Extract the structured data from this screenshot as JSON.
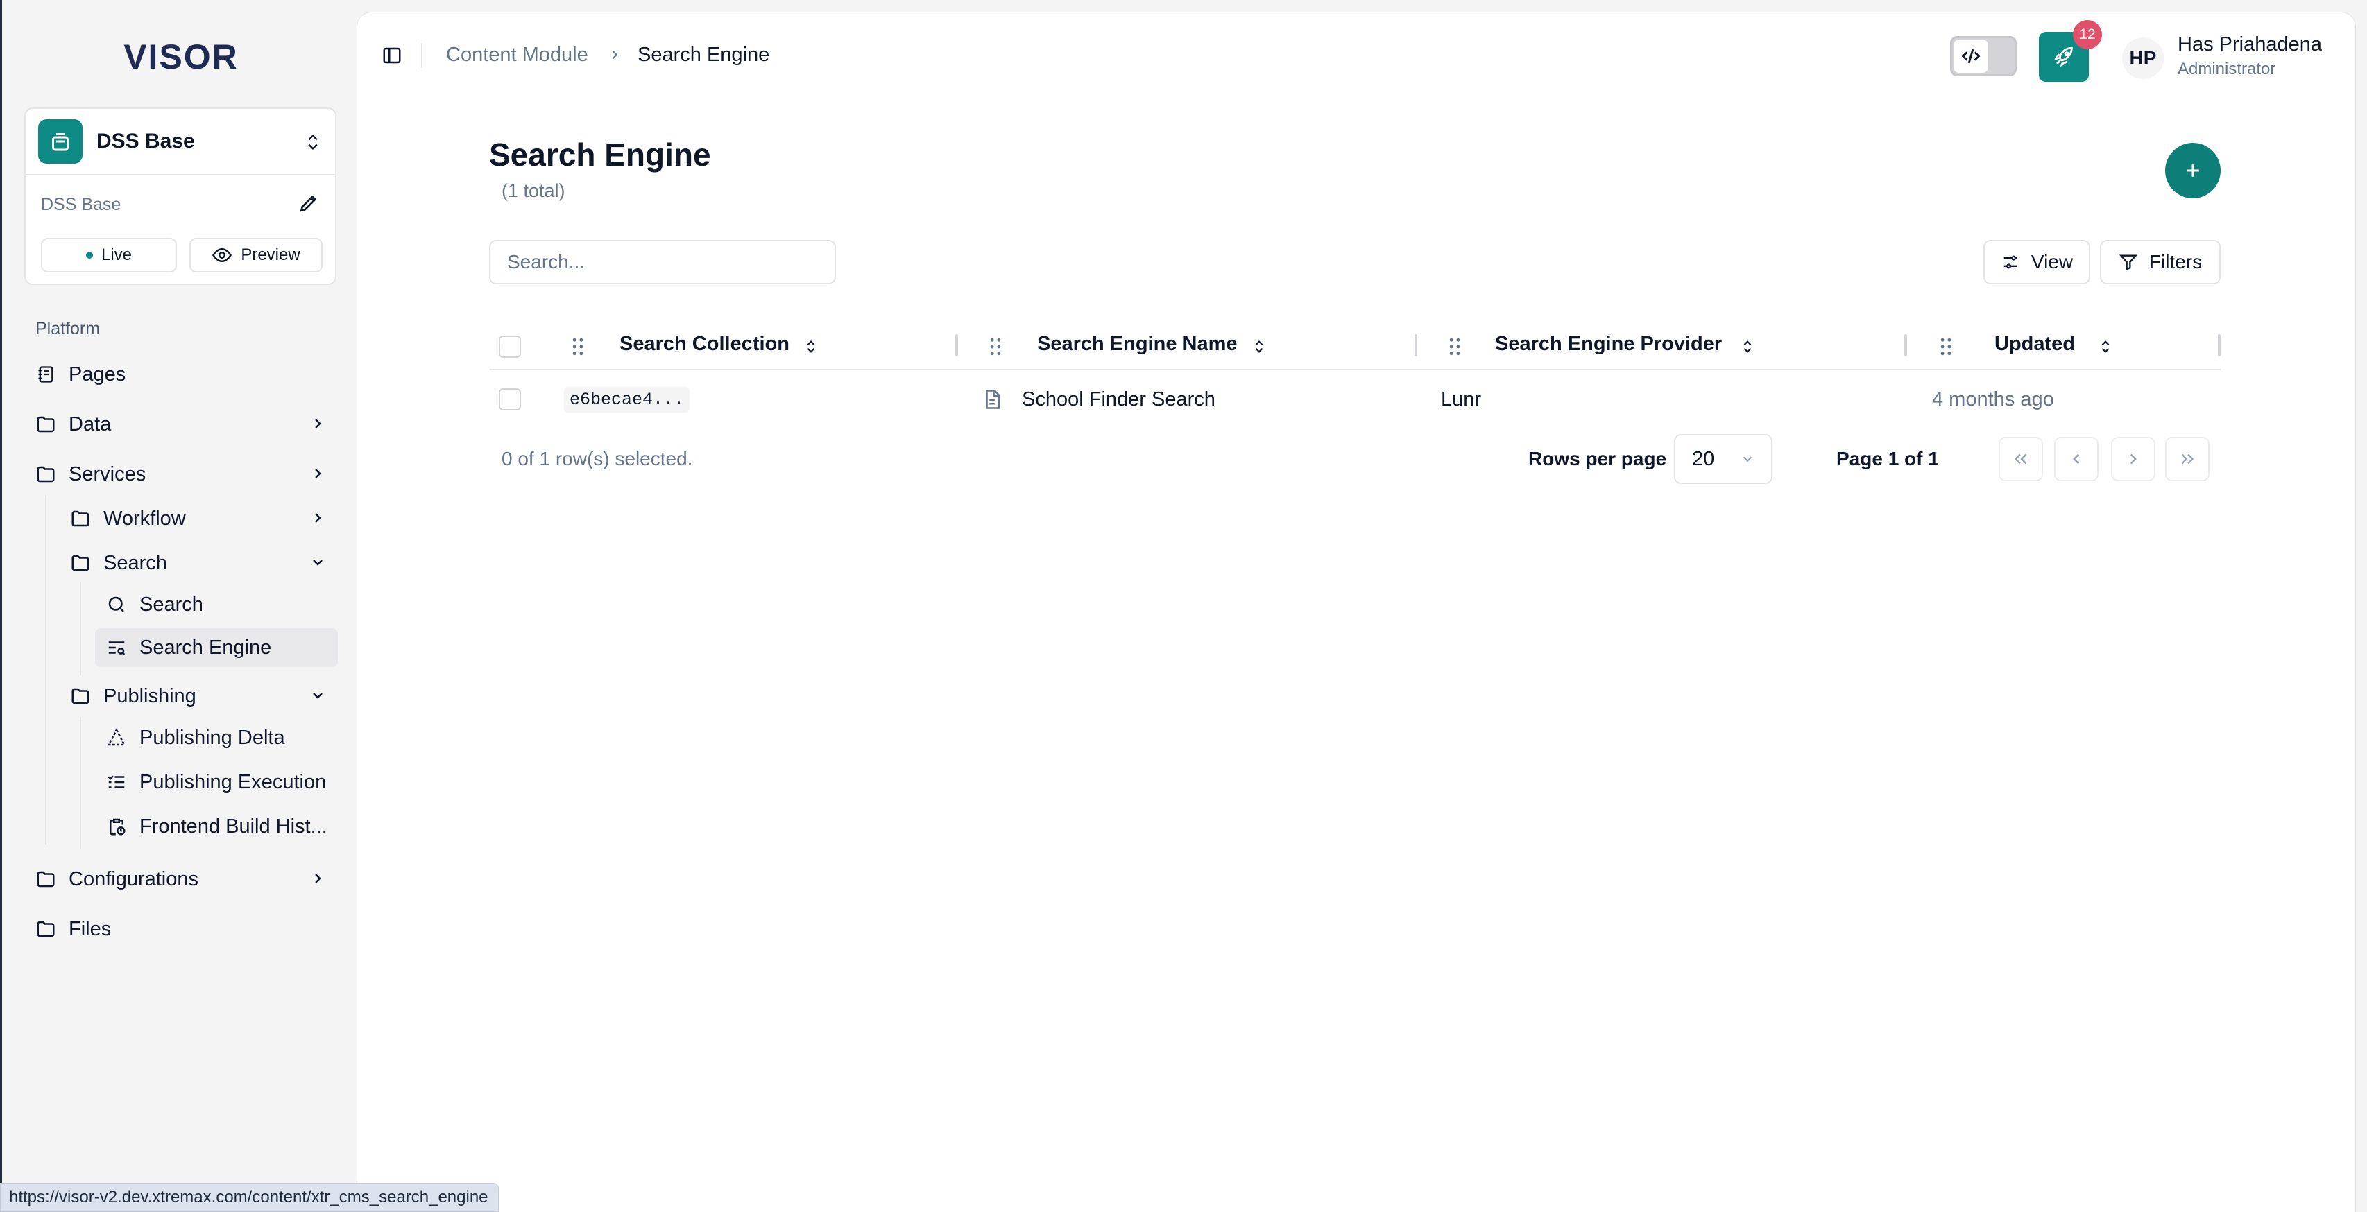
{
  "app": {
    "logo_text": "VISOR"
  },
  "workspace": {
    "name": "DSS Base",
    "subtitle": "DSS Base",
    "live_label": "Live",
    "preview_label": "Preview"
  },
  "sidebar": {
    "section_label": "Platform",
    "items": [
      {
        "label": "Pages"
      },
      {
        "label": "Data"
      },
      {
        "label": "Services"
      },
      {
        "label": "Workflow"
      },
      {
        "label": "Search"
      },
      {
        "label": "Search"
      },
      {
        "label": "Search Engine"
      },
      {
        "label": "Publishing"
      },
      {
        "label": "Publishing Delta"
      },
      {
        "label": "Publishing Execution"
      },
      {
        "label": "Frontend Build Hist..."
      },
      {
        "label": "Configurations"
      },
      {
        "label": "Files"
      }
    ]
  },
  "breadcrumb": {
    "parent": "Content Module",
    "current": "Search Engine"
  },
  "header": {
    "notification_count": "12",
    "user_initials": "HP",
    "user_name": "Has Priahadena",
    "user_role": "Administrator"
  },
  "page": {
    "title": "Search Engine",
    "count": "(1 total)",
    "search_placeholder": "Search...",
    "view_label": "View",
    "filters_label": "Filters"
  },
  "table": {
    "columns": [
      "Search Collection",
      "Search Engine Name",
      "Search Engine Provider",
      "Updated"
    ],
    "rows": [
      {
        "collection": "e6becae4...",
        "name": "School Finder Search",
        "provider": "Lunr",
        "updated": "4 months ago"
      }
    ],
    "selection_text": "0 of 1 row(s) selected.",
    "rows_per_page_label": "Rows per page",
    "rows_per_page_value": "20",
    "page_info": "Page 1 of 1"
  },
  "status_bar": {
    "url": "https://visor-v2.dev.xtremax.com/content/xtr_cms_search_engine"
  },
  "colors": {
    "accent": "#0d8a83",
    "badge": "#e0506b"
  }
}
